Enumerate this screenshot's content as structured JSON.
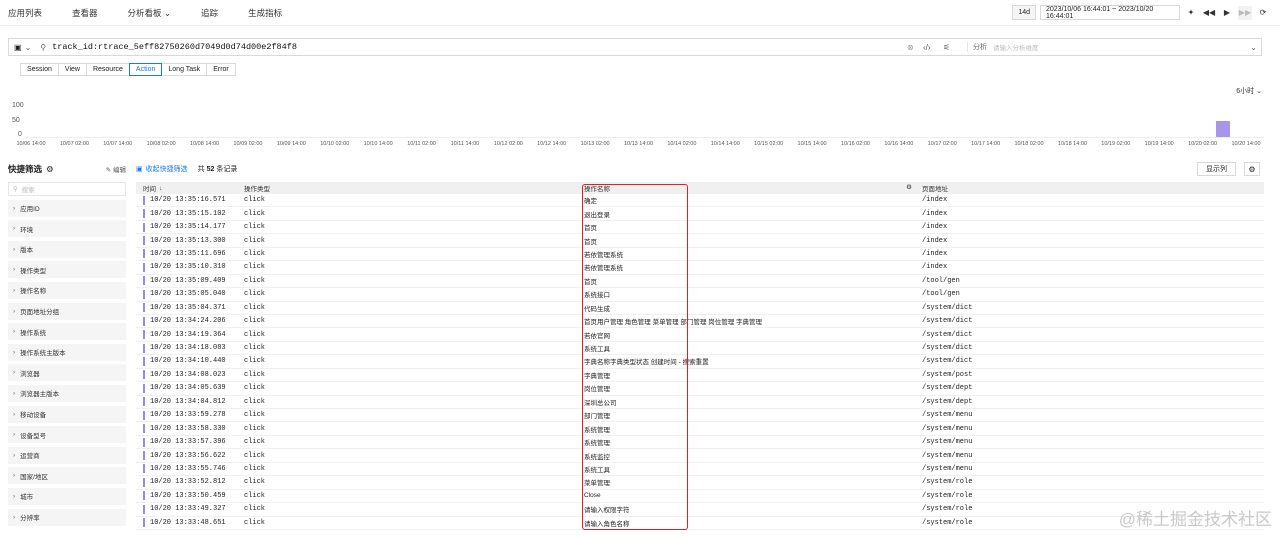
{
  "nav": {
    "items": [
      "应用列表",
      "查看器",
      "分析看板",
      "追踪",
      "生成指标"
    ],
    "range_tag": "14d",
    "time_range": "2023/10/06 16:44:01 ~ 2023/10/20 16:44:01"
  },
  "query": {
    "text": "track_id:rtrace_5eff82750260d7049d0d74d00e2f84f8",
    "analysis_label": "分析",
    "analysis_placeholder": "请输入分析维度"
  },
  "tabs": [
    "Session",
    "View",
    "Resource",
    "Action",
    "Long Task",
    "Error"
  ],
  "active_tab": "Action",
  "chart_data": {
    "type": "bar",
    "interval": "6小时",
    "yticks": [
      "100",
      "50",
      "0"
    ],
    "ylim": [
      0,
      100
    ],
    "xticks": [
      "10/06 14:00",
      "10/07 02:00",
      "10/07 14:00",
      "10/08 02:00",
      "10/08 14:00",
      "10/09 02:00",
      "10/09 14:00",
      "10/10 02:00",
      "10/10 14:00",
      "10/11 02:00",
      "10/11 14:00",
      "10/12 02:00",
      "10/12 14:00",
      "10/13 02:00",
      "10/13 14:00",
      "10/14 02:00",
      "10/14 14:00",
      "10/15 02:00",
      "10/15 14:00",
      "10/16 02:00",
      "10/16 14:00",
      "10/17 02:00",
      "10/17 14:00",
      "10/18 02:00",
      "10/18 14:00",
      "10/19 02:00",
      "10/19 14:00",
      "10/20 02:00",
      "10/20 14:00"
    ],
    "bars": [
      {
        "x": "10/20 08:00",
        "value": 52
      }
    ],
    "color": "#a895ec"
  },
  "sidebar": {
    "title": "快捷筛选",
    "edit": "编辑",
    "search_placeholder": "搜索",
    "filters": [
      "应用ID",
      "环境",
      "版本",
      "操作类型",
      "操作名称",
      "页面地址分组",
      "操作系统",
      "操作系统主版本",
      "浏览器",
      "浏览器主版本",
      "移动设备",
      "设备型号",
      "运营商",
      "国家/地区",
      "城市",
      "分辨率"
    ]
  },
  "main": {
    "collapse": "收起快捷筛选",
    "count_prefix": "共",
    "count": "52",
    "count_suffix": "条记录",
    "display_cols": "显示列",
    "columns": [
      "时间",
      "操作类型",
      "操作名称",
      "页面地址"
    ],
    "rows": [
      {
        "time": "10/20 13:35:16.571",
        "type": "click",
        "name": "确定",
        "url": "/index"
      },
      {
        "time": "10/20 13:35:15.102",
        "type": "click",
        "name": "退出登录",
        "url": "/index"
      },
      {
        "time": "10/20 13:35:14.177",
        "type": "click",
        "name": "首页",
        "url": "/index"
      },
      {
        "time": "10/20 13:35:13.300",
        "type": "click",
        "name": "首页",
        "url": "/index"
      },
      {
        "time": "10/20 13:35:11.696",
        "type": "click",
        "name": "若依管理系统",
        "url": "/index"
      },
      {
        "time": "10/20 13:35:10.310",
        "type": "click",
        "name": "若依管理系统",
        "url": "/index"
      },
      {
        "time": "10/20 13:35:09.409",
        "type": "click",
        "name": "首页",
        "url": "/tool/gen"
      },
      {
        "time": "10/20 13:35:05.040",
        "type": "click",
        "name": "系统接口",
        "url": "/tool/gen"
      },
      {
        "time": "10/20 13:35:04.371",
        "type": "click",
        "name": "代码生成",
        "url": "/system/dict"
      },
      {
        "time": "10/20 13:34:24.206",
        "type": "click",
        "name": "首页用户管理 角色管理 菜单管理 部门管理 岗位管理 字典管理",
        "url": "/system/dict"
      },
      {
        "time": "10/20 13:34:19.364",
        "type": "click",
        "name": "若依官网",
        "url": "/system/dict"
      },
      {
        "time": "10/20 13:34:18.083",
        "type": "click",
        "name": "系统工具",
        "url": "/system/dict"
      },
      {
        "time": "10/20 13:34:10.440",
        "type": "click",
        "name": "字典名称字典类型状态 创建时间 - 搜索重置",
        "url": "/system/dict"
      },
      {
        "time": "10/20 13:34:08.023",
        "type": "click",
        "name": "字典管理",
        "url": "/system/post"
      },
      {
        "time": "10/20 13:34:05.639",
        "type": "click",
        "name": "岗位管理",
        "url": "/system/dept"
      },
      {
        "time": "10/20 13:34:04.812",
        "type": "click",
        "name": "深圳总公司",
        "url": "/system/dept"
      },
      {
        "time": "10/20 13:33:59.278",
        "type": "click",
        "name": "部门管理",
        "url": "/system/menu"
      },
      {
        "time": "10/20 13:33:58.330",
        "type": "click",
        "name": "系统管理",
        "url": "/system/menu"
      },
      {
        "time": "10/20 13:33:57.396",
        "type": "click",
        "name": "系统管理",
        "url": "/system/menu"
      },
      {
        "time": "10/20 13:33:56.622",
        "type": "click",
        "name": "系统监控",
        "url": "/system/menu"
      },
      {
        "time": "10/20 13:33:55.746",
        "type": "click",
        "name": "系统工具",
        "url": "/system/menu"
      },
      {
        "time": "10/20 13:33:52.812",
        "type": "click",
        "name": "菜单管理",
        "url": "/system/role"
      },
      {
        "time": "10/20 13:33:50.459",
        "type": "click",
        "name": "Close",
        "url": "/system/role"
      },
      {
        "time": "10/20 13:33:49.327",
        "type": "click",
        "name": "请输入权限字符",
        "url": "/system/role"
      },
      {
        "time": "10/20 13:33:48.651",
        "type": "click",
        "name": "请输入角色名称",
        "url": "/system/role"
      }
    ]
  },
  "watermark": "@稀土掘金技术社区"
}
